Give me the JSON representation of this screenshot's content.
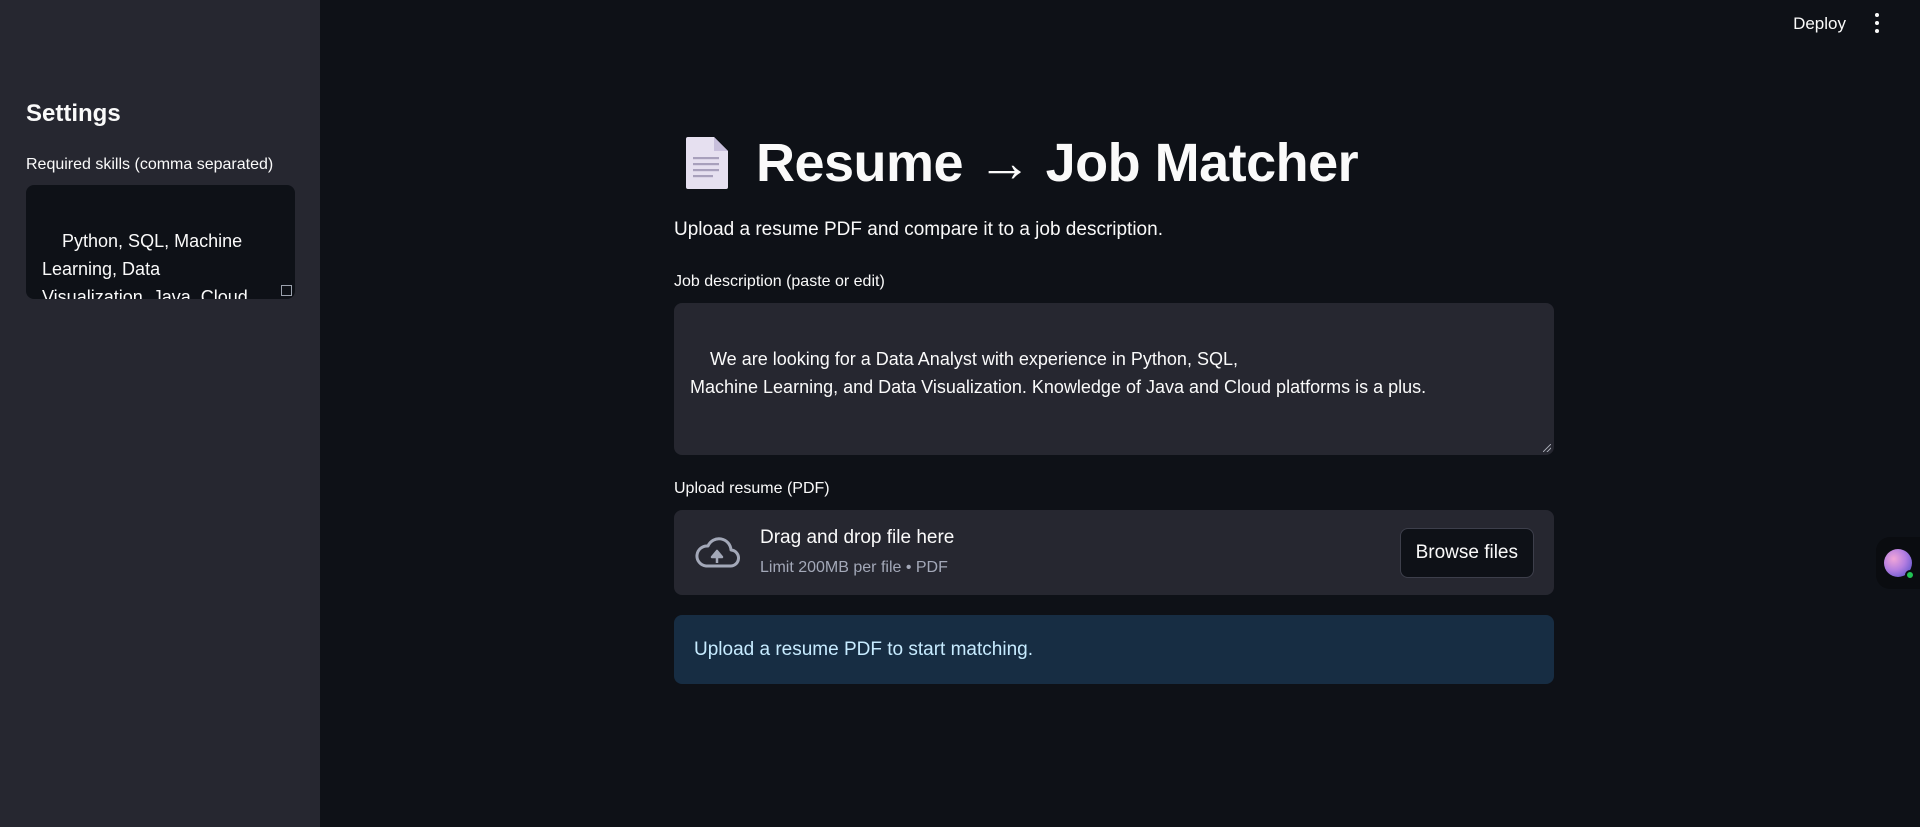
{
  "header": {
    "deploy_label": "Deploy",
    "menu_icon": "vertical-dots-icon"
  },
  "sidebar": {
    "title": "Settings",
    "skills_label": "Required skills (comma separated)",
    "skills_value": "Python, SQL, Machine\nLearning, Data\nVisualization, Java, Cloud"
  },
  "main": {
    "title_icon": "document-icon",
    "title": "Resume → Job Matcher",
    "subtitle": "Upload a resume PDF and compare it to a job description.",
    "job_description": {
      "label": "Job description (paste or edit)",
      "value": "We are looking for a Data Analyst with experience in Python, SQL,\nMachine Learning, and Data Visualization. Knowledge of Java and Cloud platforms is a plus."
    },
    "upload": {
      "label": "Upload resume (PDF)",
      "icon": "cloud-upload-icon",
      "drop_text": "Drag and drop file here",
      "limit_text": "Limit 200MB per file • PDF",
      "browse_label": "Browse files"
    },
    "info_message": "Upload a resume PDF to start matching."
  },
  "colors": {
    "background": "#0e1117",
    "sidebar": "#262730",
    "input_bg": "#262730",
    "info_bg": "#172d43",
    "info_text": "#c7ebff"
  }
}
